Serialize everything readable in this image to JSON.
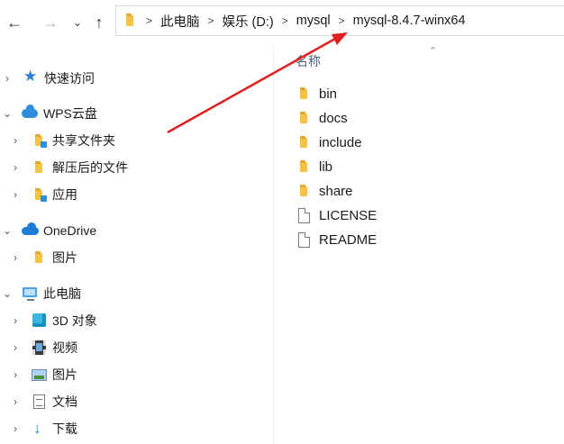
{
  "toolbar": {
    "back_icon": "arrow-left-icon",
    "forward_icon": "arrow-right-icon",
    "recent_icon": "chevron-down-icon",
    "up_icon": "arrow-up-icon"
  },
  "address": {
    "folder_icon": "folder-icon",
    "crumbs": [
      "此电脑",
      "娱乐 (D:)",
      "mysql",
      "mysql-8.4.7-winx64"
    ]
  },
  "nav_pane": {
    "items": [
      {
        "label": "快速访问",
        "icon": "star-icon",
        "level": 0
      },
      {
        "label": "WPS云盘",
        "icon": "cloud-icon",
        "level": 0,
        "expanded": true
      },
      {
        "label": "共享文件夹",
        "icon": "shared-folder-icon",
        "level": 1
      },
      {
        "label": "解压后的文件",
        "icon": "folder-icon",
        "level": 1
      },
      {
        "label": "应用",
        "icon": "app-folder-icon",
        "level": 1
      },
      {
        "label": "OneDrive",
        "icon": "onedrive-icon",
        "level": 0,
        "expanded": true
      },
      {
        "label": "图片",
        "icon": "folder-icon",
        "level": 1
      },
      {
        "label": "此电脑",
        "icon": "computer-icon",
        "level": 0,
        "expanded": true
      },
      {
        "label": "3D 对象",
        "icon": "cube-icon",
        "level": 1
      },
      {
        "label": "视频",
        "icon": "video-icon",
        "level": 1
      },
      {
        "label": "图片",
        "icon": "picture-icon",
        "level": 1
      },
      {
        "label": "文档",
        "icon": "document-icon",
        "level": 1
      },
      {
        "label": "下载",
        "icon": "download-icon",
        "level": 1
      }
    ]
  },
  "content": {
    "column_header": "名称",
    "files": [
      {
        "name": "bin",
        "type": "folder"
      },
      {
        "name": "docs",
        "type": "folder"
      },
      {
        "name": "include",
        "type": "folder"
      },
      {
        "name": "lib",
        "type": "folder"
      },
      {
        "name": "share",
        "type": "folder"
      },
      {
        "name": "LICENSE",
        "type": "file"
      },
      {
        "name": "README",
        "type": "file"
      }
    ]
  },
  "annotation": {
    "color": "#e02020"
  }
}
